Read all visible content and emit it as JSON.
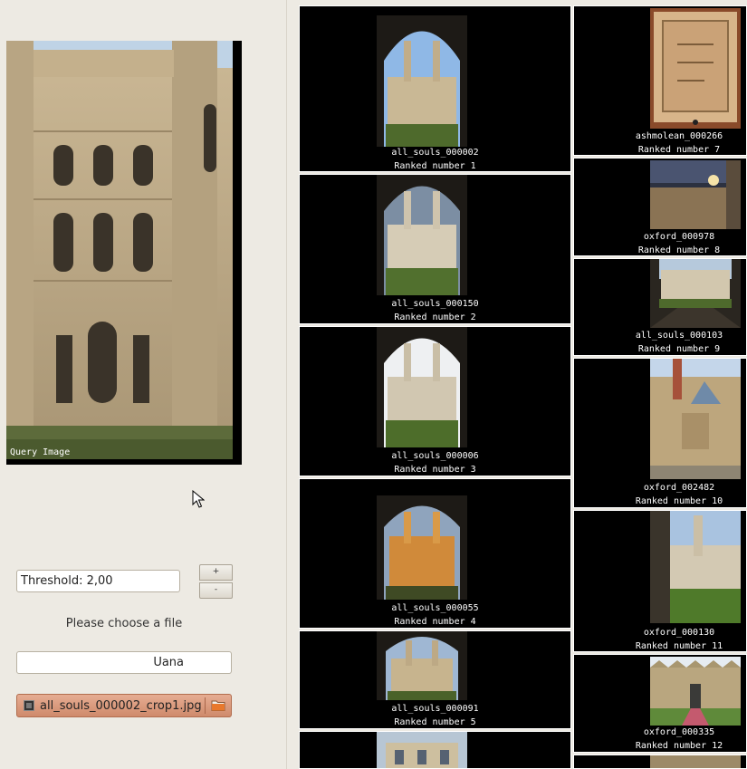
{
  "query": {
    "caption": "Query Image"
  },
  "controls": {
    "threshold": "Threshold: 2,00",
    "spin_up": "+",
    "spin_down": "-",
    "choose_file_label": "Please choose a file",
    "name_value": "Uana",
    "file_chooser_value": "all_souls_000002_crop1.jpg"
  },
  "results": [
    {
      "name": "all_souls_000002",
      "rank": "Ranked number 1"
    },
    {
      "name": "all_souls_000150",
      "rank": "Ranked number 2"
    },
    {
      "name": "all_souls_000006",
      "rank": "Ranked number 3"
    },
    {
      "name": "all_souls_000055",
      "rank": "Ranked number 4"
    },
    {
      "name": "all_souls_000091",
      "rank": "Ranked number 5"
    },
    {
      "name": "ashmolean_000266",
      "rank": "Ranked number 7"
    },
    {
      "name": "oxford_000978",
      "rank": "Ranked number 8"
    },
    {
      "name": "all_souls_000103",
      "rank": "Ranked number 9"
    },
    {
      "name": "oxford_002482",
      "rank": "Ranked number 10"
    },
    {
      "name": "oxford_000130",
      "rank": "Ranked number 11"
    },
    {
      "name": "oxford_000335",
      "rank": "Ranked number 12"
    }
  ]
}
